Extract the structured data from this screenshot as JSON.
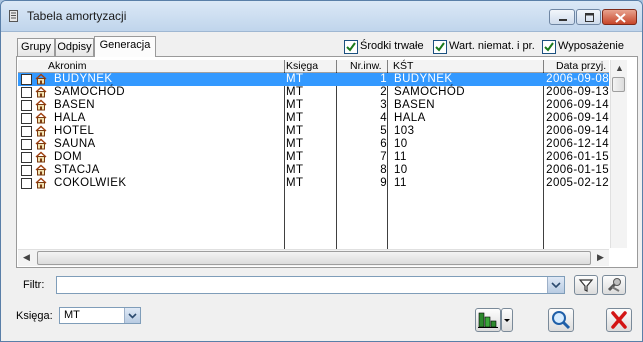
{
  "window": {
    "title": "Tabela amortyzacji"
  },
  "tabs": [
    {
      "label": "Grupy",
      "active": false
    },
    {
      "label": "Odpisy",
      "active": false
    },
    {
      "label": "Generacja",
      "active": true
    }
  ],
  "filters": [
    {
      "label": "Środki trwałe",
      "checked": true
    },
    {
      "label": "Wart. niemat. i pr.",
      "checked": true
    },
    {
      "label": "Wyposażenie",
      "checked": true
    }
  ],
  "table": {
    "columns": [
      "Akronim",
      "Księga",
      "Nr.inw.",
      "KŚT",
      "Data przyj."
    ],
    "rows": [
      {
        "akronim": "BUDYNEK",
        "ksiega": "MT",
        "nr": "1",
        "kst": "BUDYNEK",
        "data": "2006-09-08",
        "selected": true
      },
      {
        "akronim": "SAMOCHÓD",
        "ksiega": "MT",
        "nr": "2",
        "kst": "SAMOCHÓD",
        "data": "2006-09-13",
        "selected": false
      },
      {
        "akronim": "BASEN",
        "ksiega": "MT",
        "nr": "3",
        "kst": "BASEN",
        "data": "2006-09-14",
        "selected": false
      },
      {
        "akronim": "HALA",
        "ksiega": "MT",
        "nr": "4",
        "kst": "HALA",
        "data": "2006-09-14",
        "selected": false
      },
      {
        "akronim": "HOTEL",
        "ksiega": "MT",
        "nr": "5",
        "kst": "103",
        "data": "2006-09-14",
        "selected": false
      },
      {
        "akronim": "SAUNA",
        "ksiega": "MT",
        "nr": "6",
        "kst": "10",
        "data": "2006-12-14",
        "selected": false
      },
      {
        "akronim": "DOM",
        "ksiega": "MT",
        "nr": "7",
        "kst": "11",
        "data": "2006-01-15",
        "selected": false
      },
      {
        "akronim": "STACJA",
        "ksiega": "MT",
        "nr": "8",
        "kst": "10",
        "data": "2006-01-15",
        "selected": false
      },
      {
        "akronim": "COKOLWIEK",
        "ksiega": "MT",
        "nr": "9",
        "kst": "11",
        "data": "2005-02-12",
        "selected": false
      }
    ]
  },
  "filter_bar": {
    "label": "Filtr:",
    "value": ""
  },
  "ksiega": {
    "label": "Księga:",
    "value": "MT"
  },
  "icons": {
    "row_icon": "house-icon",
    "filter_btn": "funnel-icon",
    "tools_btn": "wrench-icon",
    "generate_btn": "chart-generate-icon",
    "search_btn": "magnifier-icon",
    "close_btn": "red-x-icon"
  },
  "colors": {
    "selection": "#3399ff",
    "accent_red": "#d31515"
  }
}
